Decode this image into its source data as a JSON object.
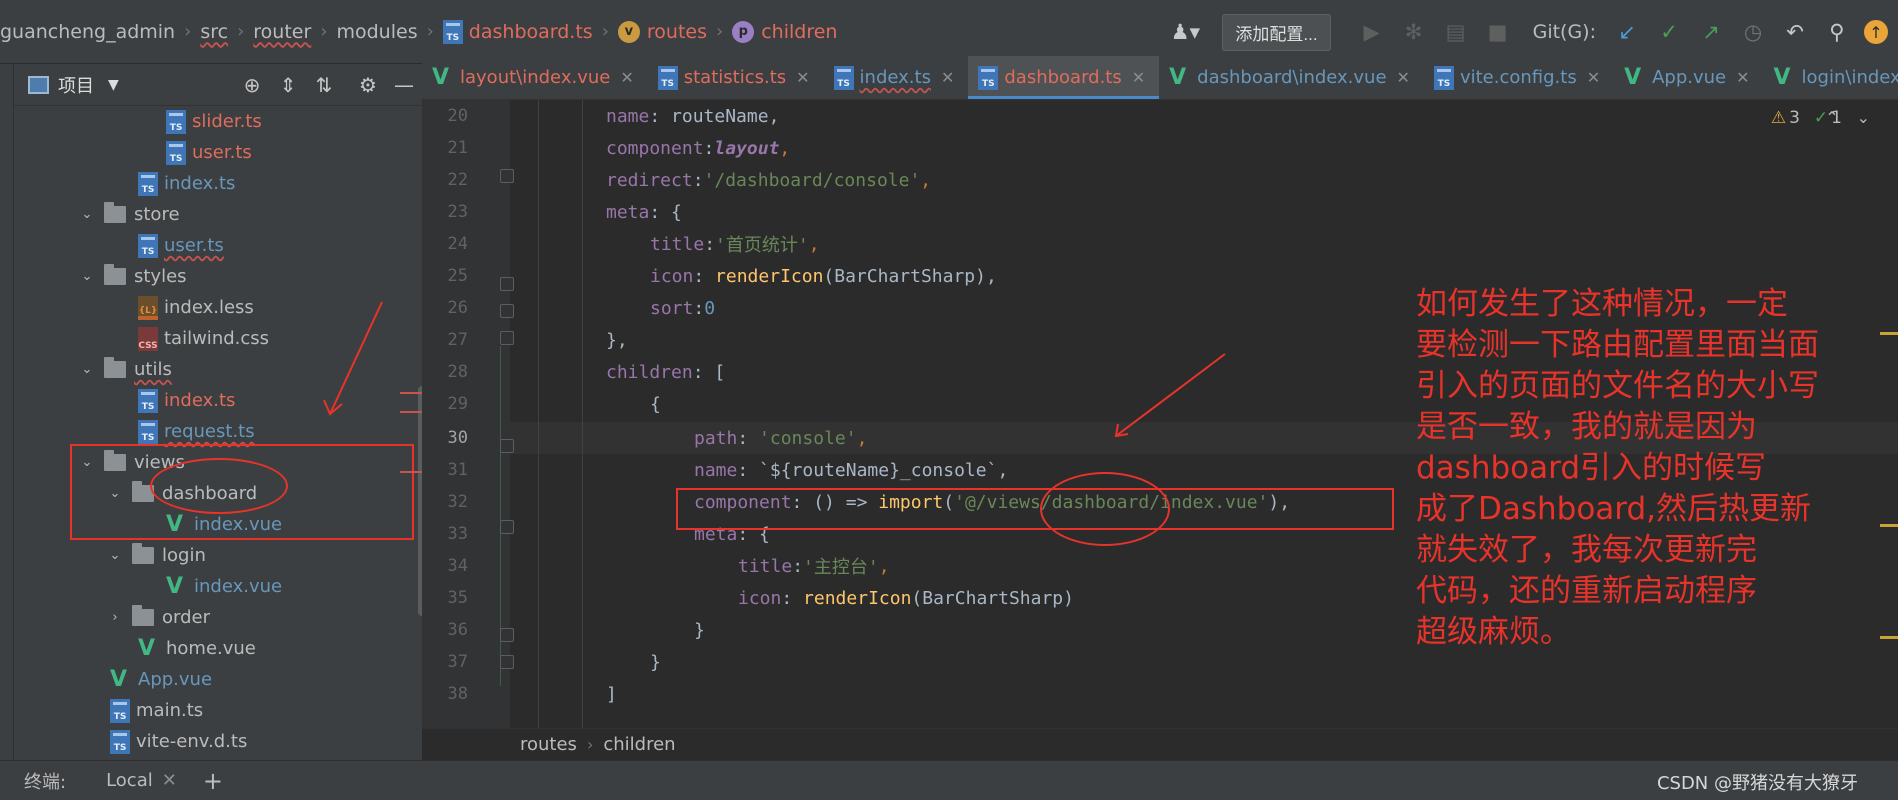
{
  "breadcrumb": {
    "items": [
      {
        "label": "guancheng_admin"
      },
      {
        "label": "src"
      },
      {
        "label": "router"
      },
      {
        "label": "modules"
      },
      {
        "label": "dashboard.ts"
      },
      {
        "label": "routes",
        "badge": "v"
      },
      {
        "label": "children",
        "badge": "p"
      }
    ]
  },
  "toolbar": {
    "add_config_label": "添加配置...",
    "git_label": "Git(G):"
  },
  "project": {
    "title": "项目",
    "tree": [
      {
        "label": "slider.ts"
      },
      {
        "label": "user.ts"
      },
      {
        "label": "index.ts"
      },
      {
        "label": "store"
      },
      {
        "label": "user.ts"
      },
      {
        "label": "styles"
      },
      {
        "label": "index.less"
      },
      {
        "label": "tailwind.css"
      },
      {
        "label": "utils"
      },
      {
        "label": "index.ts"
      },
      {
        "label": "request.ts"
      },
      {
        "label": "views"
      },
      {
        "label": "dashboard"
      },
      {
        "label": "index.vue"
      },
      {
        "label": "login"
      },
      {
        "label": "index.vue"
      },
      {
        "label": "order"
      },
      {
        "label": "home.vue"
      },
      {
        "label": "App.vue"
      },
      {
        "label": "main.ts"
      },
      {
        "label": "vite-env.d.ts"
      }
    ],
    "badges": {
      "ts": "TS",
      "less": "{L}",
      "css": "CSS"
    }
  },
  "tabs": [
    {
      "label": "layout\\index.vue"
    },
    {
      "label": "statistics.ts"
    },
    {
      "label": "index.ts"
    },
    {
      "label": "dashboard.ts"
    },
    {
      "label": "dashboard\\index.vue"
    },
    {
      "label": "vite.config.ts"
    },
    {
      "label": "App.vue"
    },
    {
      "label": "login\\index.vue"
    }
  ],
  "editor": {
    "line_numbers": [
      "20",
      "21",
      "22",
      "23",
      "24",
      "25",
      "26",
      "27",
      "28",
      "29",
      "30",
      "31",
      "32",
      "33",
      "34",
      "35",
      "36",
      "37",
      "38"
    ],
    "warnings": "3",
    "checks": "1",
    "code": {
      "l20": {
        "a": "name",
        "b": ": routeName,"
      },
      "l21": {
        "a": "component",
        "b": ":",
        "c": "layout",
        "d": ","
      },
      "l22": {
        "a": "redirect",
        "b": ":",
        "c": "'/dashboard/console'",
        "d": ","
      },
      "l23": {
        "a": "meta",
        "b": ": {"
      },
      "l24": {
        "a": "title",
        "b": ":",
        "c": "'首页统计'",
        "d": ","
      },
      "l25": {
        "a": "icon",
        "b": ": ",
        "c": "renderIcon",
        "d": "(BarChartSharp),"
      },
      "l26": {
        "a": "sort",
        "b": ":",
        "c": "0"
      },
      "l27": {
        "a": "},"
      },
      "l28": {
        "a": "children",
        "b": ": ["
      },
      "l29": {
        "a": "{"
      },
      "l30": {
        "a": "path",
        "b": ": ",
        "c": "'console'",
        "d": ","
      },
      "l31": {
        "a": "name",
        "b": ": `${routeName}_console`,"
      },
      "l32": {
        "a": "component",
        "b": ": () => ",
        "c": "import",
        "d": "(",
        "e": "'@/views/dashboard/index.vue'",
        "f": "),"
      },
      "l33": {
        "a": "meta",
        "b": ": {"
      },
      "l34": {
        "a": "title",
        "b": ":",
        "c": "'主控台'",
        "d": ","
      },
      "l35": {
        "a": "icon",
        "b": ": ",
        "c": "renderIcon",
        "d": "(BarChartSharp)"
      },
      "l36": {
        "a": "}"
      },
      "l37": {
        "a": "}"
      },
      "l38": {
        "a": "]"
      }
    }
  },
  "annotation": {
    "lines": [
      "如何发生了这种情况，一定",
      "要检测一下路由配置里面当面",
      "引入的页面的文件名的大小写",
      "是否一致，我的就是因为",
      "dashboard引入的时候写",
      "成了Dashboard,然后热更新",
      "就失效了，我每次更新完",
      "代码，还的重新启动程序",
      "超级麻烦。"
    ]
  },
  "editor_breadcrumb": [
    "routes",
    "children"
  ],
  "terminal": {
    "label": "终端:",
    "tab": "Local",
    "plus": "+"
  },
  "watermark": "CSDN @野猪没有大獠牙"
}
